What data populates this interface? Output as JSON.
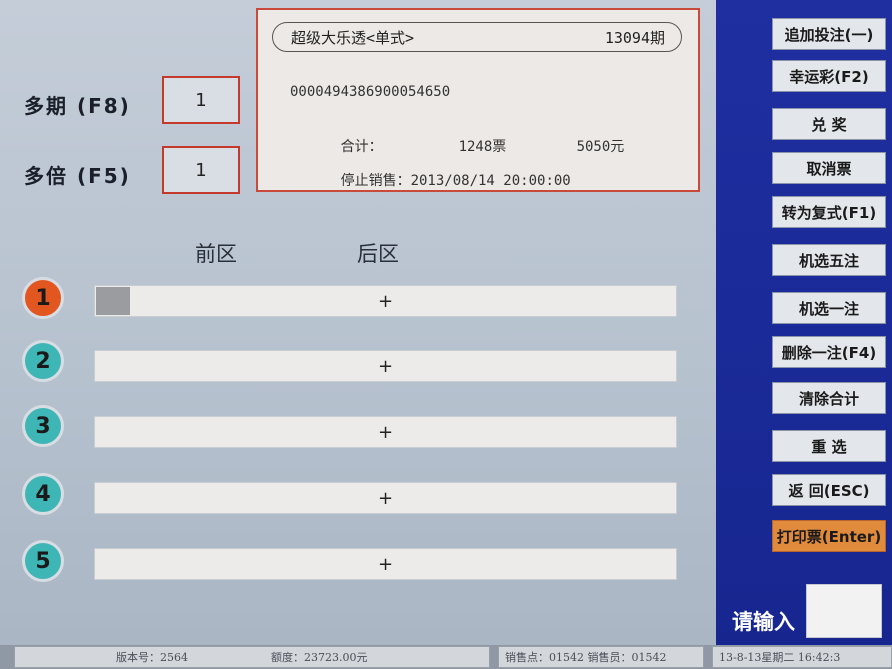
{
  "fields": {
    "multi_period": {
      "label": "多期 (F8)",
      "value": "1"
    },
    "multi_times": {
      "label": "多倍 (F5)",
      "value": "1"
    }
  },
  "ticket": {
    "game": "超级大乐透<单式>",
    "period": "13094期",
    "serial": "0000494386900054650",
    "total_label": "合计：",
    "tickets": "1248票",
    "amount": "5050元",
    "stop_label": "停止销售：",
    "stop_time": "2013/08/14 20:00:00"
  },
  "zones": {
    "front": "前区",
    "back": "后区"
  },
  "rows": [
    {
      "num": "1",
      "value": "+"
    },
    {
      "num": "2",
      "value": "+"
    },
    {
      "num": "3",
      "value": "+"
    },
    {
      "num": "4",
      "value": "+"
    },
    {
      "num": "5",
      "value": "+"
    }
  ],
  "sidebar": {
    "buttons": [
      "追加投注(一)",
      "幸运彩(F2)",
      "兑 奖",
      "取消票",
      "转为复式(F1)",
      "机选五注",
      "机选一注",
      "删除一注(F4)",
      "清除合计",
      "重 选",
      "返 回(ESC)",
      "打印票(Enter)"
    ],
    "input_label": "请输入",
    "input_value": ""
  },
  "status": {
    "version": "版本号：2564",
    "quota": "额度：23723.00元",
    "seller": "销售点：01542  销售员：01542",
    "datetime": "13-8-13星期二  16:42:3"
  },
  "colors": {
    "sidebar": "#1f2fa0",
    "accent_border": "#c33a2c",
    "primary_button": "#e08a3c",
    "row1_circle": "#e2561f",
    "row_circle": "#3fb6b6"
  }
}
